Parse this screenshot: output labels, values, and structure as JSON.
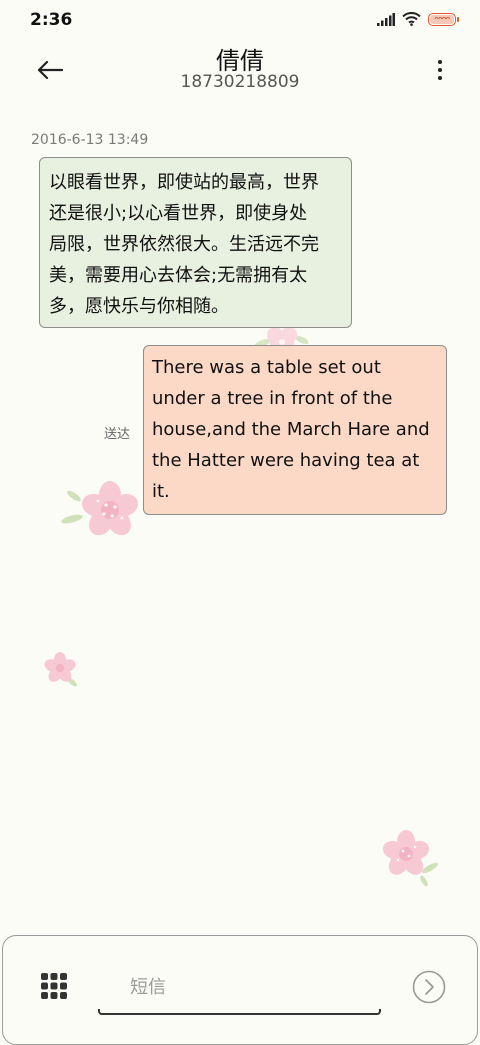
{
  "status_bar": {
    "time": "2:36",
    "battery_text": "ᴖᴖᴖᴖ",
    "icons": [
      "signal-icon",
      "wifi-icon",
      "battery-icon"
    ]
  },
  "header": {
    "back_icon": "back-arrow-icon",
    "contact_name": "倩倩",
    "contact_number": "18730218809",
    "more_icon": "more-vertical-icon"
  },
  "conversation": {
    "timestamp": "2016-6-13 13:49",
    "messages": [
      {
        "direction": "incoming",
        "lines": [
          "以眼看世界，即使站的最高，世界",
          "还是很小;以心看世界，即使身处",
          "局限，世界依然很大。生活远不完",
          "美，需要用心去体会;无需拥有太",
          "多，愿快乐与你相随。"
        ]
      },
      {
        "direction": "outgoing",
        "status": "送达",
        "lines": [
          "There was a table set out",
          "under a tree in front of the",
          "house,and the March Hare and",
          "the Hatter were having tea at",
          "it."
        ]
      }
    ]
  },
  "composer": {
    "apps_icon": "apps-grid-icon",
    "placeholder": "短信",
    "value": "",
    "send_icon": "send-arrow-icon"
  },
  "colors": {
    "background": "#fbfcf6",
    "incoming_bubble": "#e8f0e0",
    "outgoing_bubble": "#fbd9c6",
    "battery_accent": "#e05b32",
    "blossom": "#f7c9d4"
  }
}
